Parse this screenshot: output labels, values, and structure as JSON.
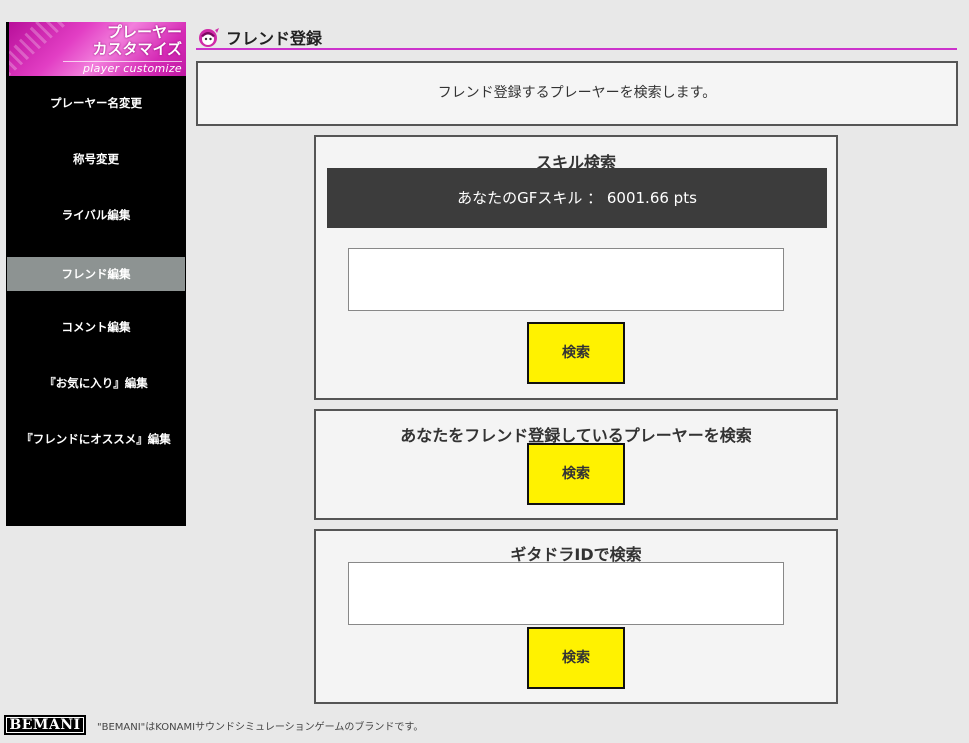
{
  "sidebar": {
    "banner_title_1": "プレーヤー",
    "banner_title_2": "カスタマイズ",
    "banner_sub": "player customize",
    "items": [
      {
        "label": "プレーヤー名変更"
      },
      {
        "label": "称号変更"
      },
      {
        "label": "ライバル編集"
      },
      {
        "label": "フレンド編集",
        "active": true
      },
      {
        "label": "コメント編集"
      },
      {
        "label": "『お気に入り』編集"
      },
      {
        "label": "『フレンドにオススメ』編集"
      }
    ],
    "accent_color": "#cc33cc"
  },
  "page": {
    "title": "フレンド登録",
    "notice": "フレンド登録するプレーヤーを検索します。"
  },
  "skill_search": {
    "title": "スキル検索",
    "skill_text": "あなたのGFスキル ： 6001.66 pts",
    "input_value": "",
    "button_label": "検索"
  },
  "reverse_search": {
    "title": "あなたをフレンド登録しているプレーヤーを検索",
    "button_label": "検索"
  },
  "id_search": {
    "title": "ギタドラIDで検索",
    "input_value": "",
    "button_label": "検索"
  },
  "footer": {
    "logo": "BEMANI",
    "text": "\"BEMANI\"はKONAMIサウンドシミュレーションゲームのブランドです。"
  },
  "colors": {
    "button": "#fff200",
    "active_item": "#8d9392",
    "skill_bar": "#3c3c3c"
  }
}
